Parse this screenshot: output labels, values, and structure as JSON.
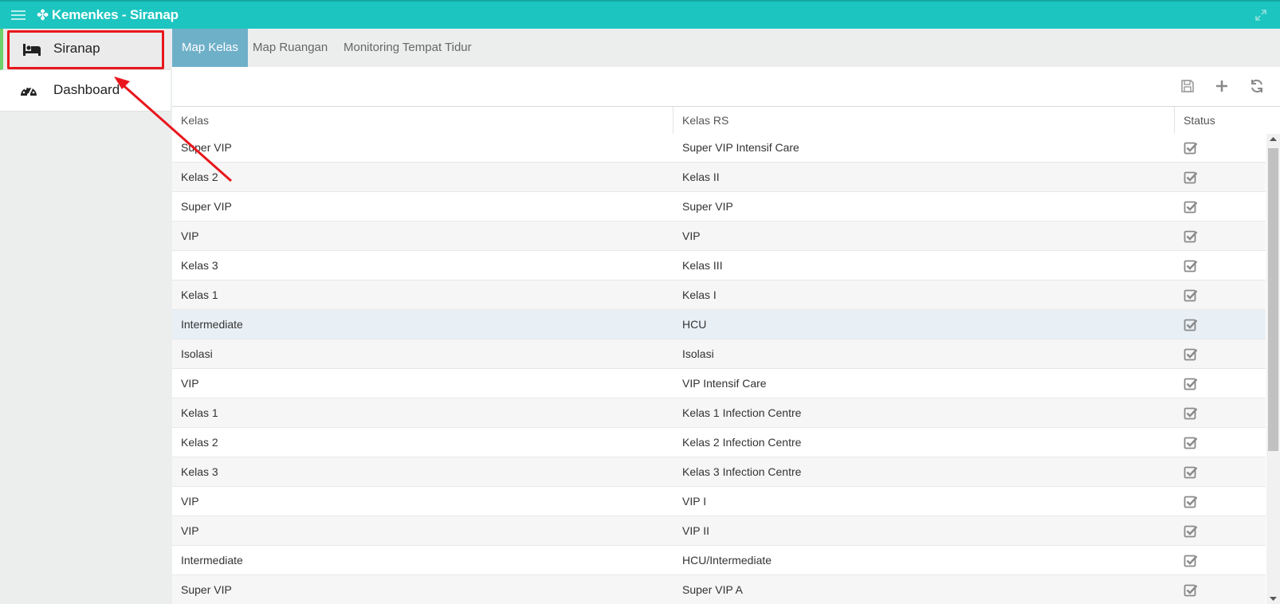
{
  "header": {
    "app_title": "Kemenkes - Siranap",
    "brand_color": "#1cc5c0"
  },
  "sidebar": {
    "items": [
      {
        "label": "Siranap",
        "icon": "bed-icon",
        "active": true
      },
      {
        "label": "Dashboard",
        "icon": "dashboard-gauge-icon",
        "active": false
      }
    ]
  },
  "tabs": [
    {
      "label": "Map Kelas",
      "active": true
    },
    {
      "label": "Map Ruangan",
      "active": false
    },
    {
      "label": "Monitoring Tempat Tidur",
      "active": false
    }
  ],
  "toolbar": {
    "icons": [
      "save-icon",
      "add-icon",
      "refresh-icon"
    ]
  },
  "table": {
    "columns": [
      "Kelas",
      "Kelas RS",
      "Status"
    ],
    "rows": [
      {
        "kelas": "Super VIP",
        "kelas_rs": "Super VIP Intensif Care",
        "status": true
      },
      {
        "kelas": "Kelas 2",
        "kelas_rs": "Kelas II",
        "status": true
      },
      {
        "kelas": "Super VIP",
        "kelas_rs": "Super VIP",
        "status": true
      },
      {
        "kelas": "VIP",
        "kelas_rs": "VIP",
        "status": true
      },
      {
        "kelas": "Kelas 3",
        "kelas_rs": "Kelas III",
        "status": true
      },
      {
        "kelas": "Kelas 1",
        "kelas_rs": "Kelas I",
        "status": true
      },
      {
        "kelas": "Intermediate",
        "kelas_rs": "HCU",
        "status": true
      },
      {
        "kelas": "Isolasi",
        "kelas_rs": "Isolasi",
        "status": true
      },
      {
        "kelas": "VIP",
        "kelas_rs": "VIP Intensif Care",
        "status": true
      },
      {
        "kelas": "Kelas 1",
        "kelas_rs": "Kelas 1 Infection Centre",
        "status": true
      },
      {
        "kelas": "Kelas 2",
        "kelas_rs": "Kelas 2 Infection Centre",
        "status": true
      },
      {
        "kelas": "Kelas 3",
        "kelas_rs": "Kelas 3 Infection Centre",
        "status": true
      },
      {
        "kelas": "VIP",
        "kelas_rs": "VIP I",
        "status": true
      },
      {
        "kelas": "VIP",
        "kelas_rs": "VIP II",
        "status": true
      },
      {
        "kelas": "Intermediate",
        "kelas_rs": "HCU/Intermediate",
        "status": true
      },
      {
        "kelas": "Super VIP",
        "kelas_rs": "Super VIP A",
        "status": true
      }
    ]
  },
  "annotation": {
    "highlight_color": "#e8161c"
  }
}
